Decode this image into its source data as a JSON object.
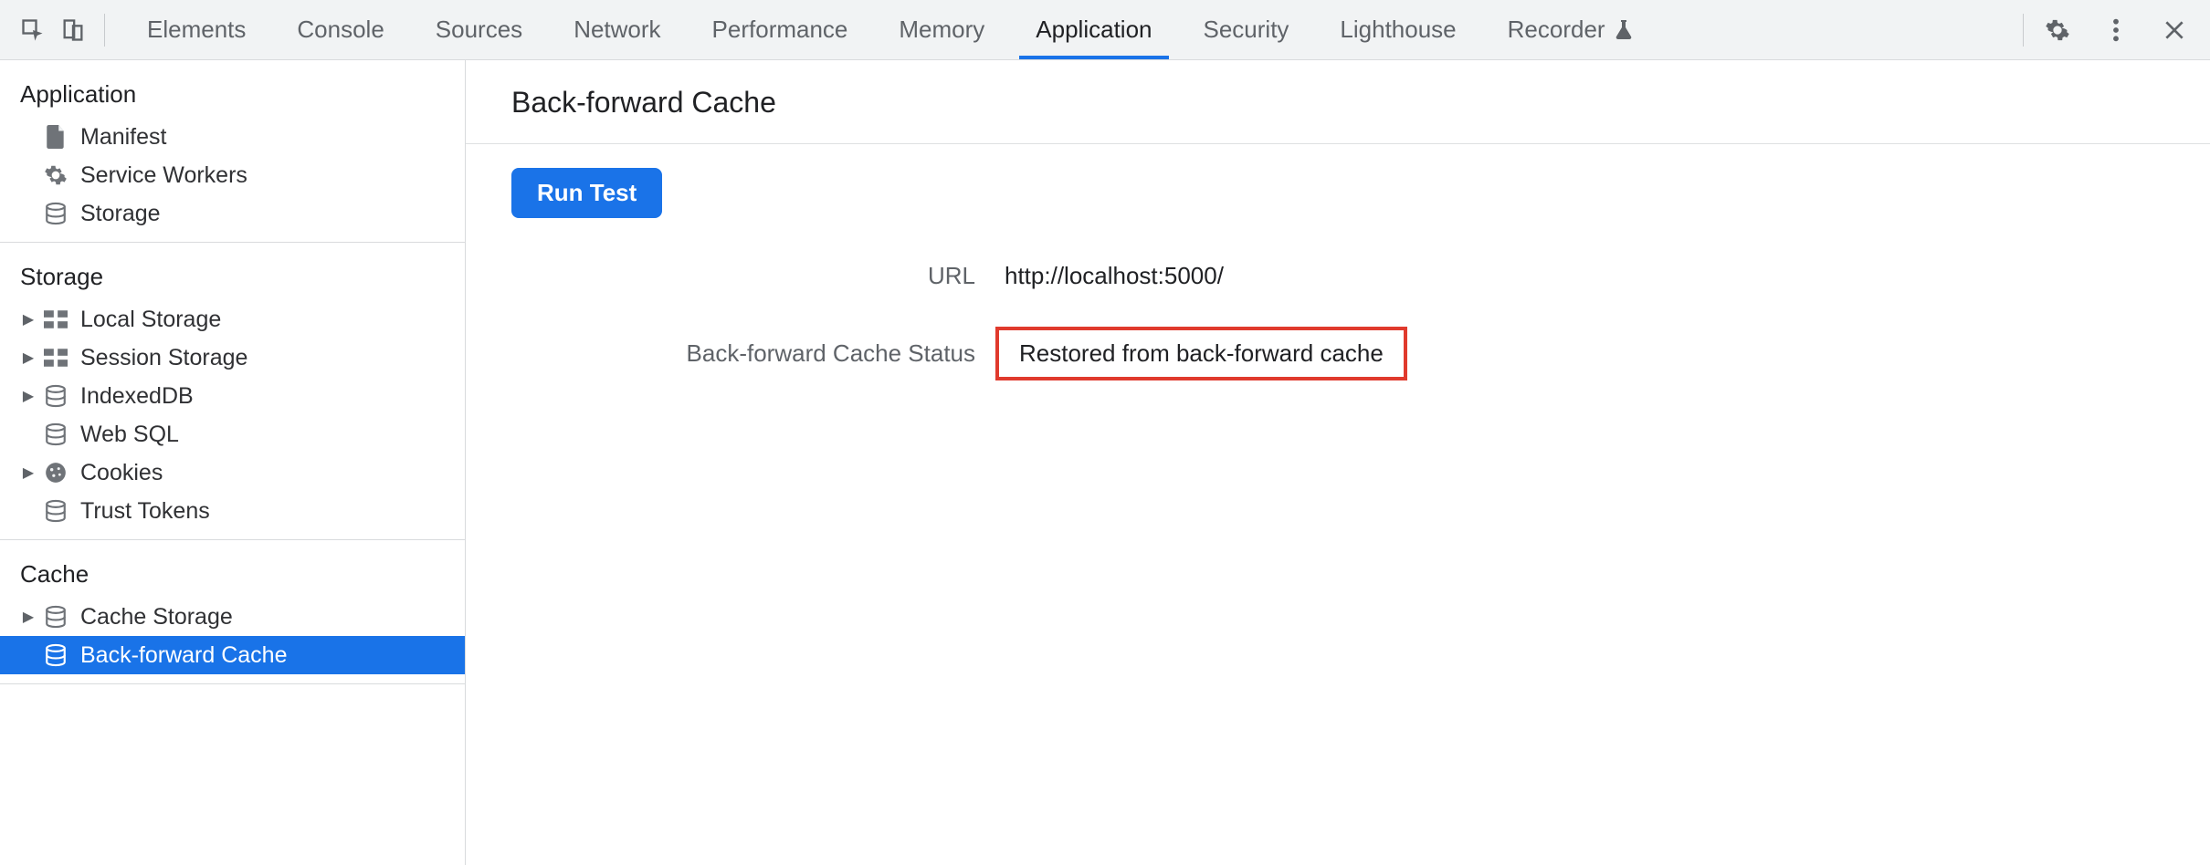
{
  "tabs": [
    {
      "label": "Elements",
      "active": false
    },
    {
      "label": "Console",
      "active": false
    },
    {
      "label": "Sources",
      "active": false
    },
    {
      "label": "Network",
      "active": false
    },
    {
      "label": "Performance",
      "active": false
    },
    {
      "label": "Memory",
      "active": false
    },
    {
      "label": "Application",
      "active": true
    },
    {
      "label": "Security",
      "active": false
    },
    {
      "label": "Lighthouse",
      "active": false
    },
    {
      "label": "Recorder",
      "active": false,
      "experimental": true
    }
  ],
  "sidebar": {
    "sections": [
      {
        "title": "Application",
        "items": [
          {
            "label": "Manifest",
            "icon": "file",
            "expandable": false,
            "selected": false
          },
          {
            "label": "Service Workers",
            "icon": "gear",
            "expandable": false,
            "selected": false
          },
          {
            "label": "Storage",
            "icon": "db",
            "expandable": false,
            "selected": false
          }
        ]
      },
      {
        "title": "Storage",
        "items": [
          {
            "label": "Local Storage",
            "icon": "grid",
            "expandable": true,
            "selected": false
          },
          {
            "label": "Session Storage",
            "icon": "grid",
            "expandable": true,
            "selected": false
          },
          {
            "label": "IndexedDB",
            "icon": "db",
            "expandable": true,
            "selected": false
          },
          {
            "label": "Web SQL",
            "icon": "db",
            "expandable": false,
            "selected": false
          },
          {
            "label": "Cookies",
            "icon": "cookie",
            "expandable": true,
            "selected": false
          },
          {
            "label": "Trust Tokens",
            "icon": "db",
            "expandable": false,
            "selected": false
          }
        ]
      },
      {
        "title": "Cache",
        "items": [
          {
            "label": "Cache Storage",
            "icon": "db",
            "expandable": true,
            "selected": false
          },
          {
            "label": "Back-forward Cache",
            "icon": "db",
            "expandable": false,
            "selected": true
          }
        ]
      }
    ]
  },
  "page": {
    "title": "Back-forward Cache",
    "run_button": "Run Test",
    "rows": [
      {
        "label": "URL",
        "value": "http://localhost:5000/",
        "highlight": false
      },
      {
        "label": "Back-forward Cache Status",
        "value": "Restored from back-forward cache",
        "highlight": true
      }
    ]
  }
}
